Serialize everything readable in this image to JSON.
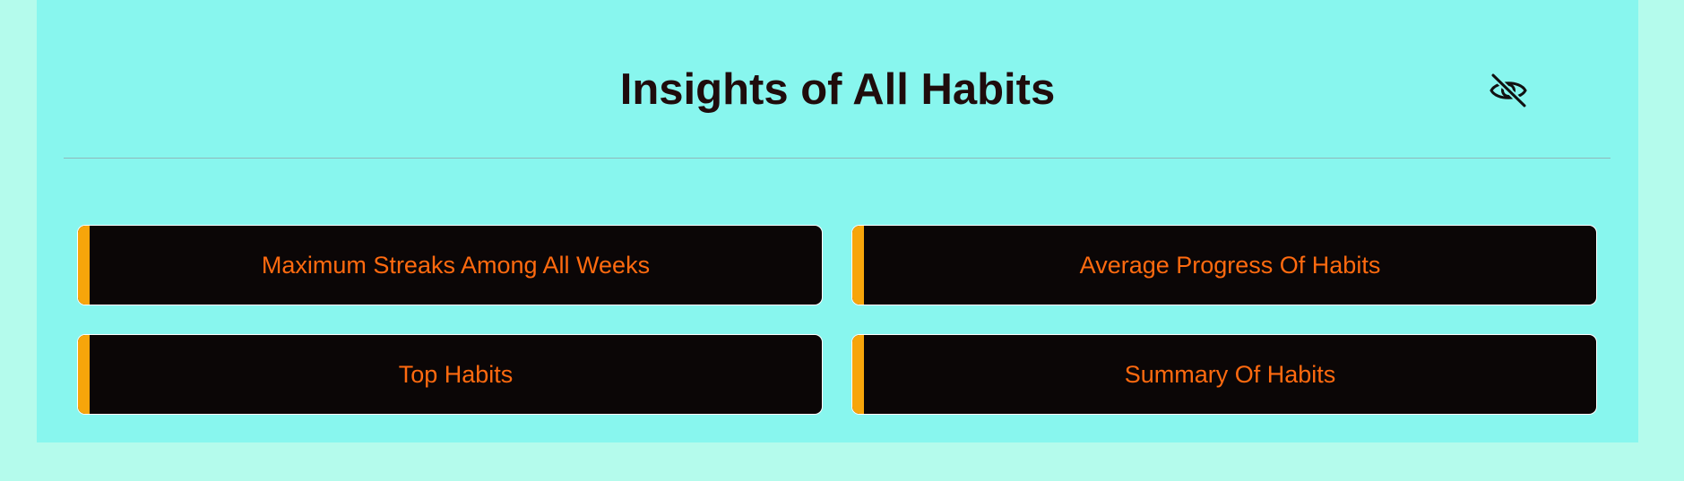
{
  "header": {
    "title": "Insights of All Habits",
    "visibility_icon": "eye-off-icon"
  },
  "colors": {
    "page_background": "#b4fbec",
    "panel_background": "#88f6ee",
    "card_background": "#0b0606",
    "card_accent": "#f7a50a",
    "card_text": "#ff6a0f",
    "title_text": "#1f0c0c"
  },
  "cards": [
    {
      "label": "Maximum Streaks Among All Weeks"
    },
    {
      "label": "Average Progress Of Habits"
    },
    {
      "label": "Top Habits"
    },
    {
      "label": "Summary Of Habits"
    }
  ]
}
